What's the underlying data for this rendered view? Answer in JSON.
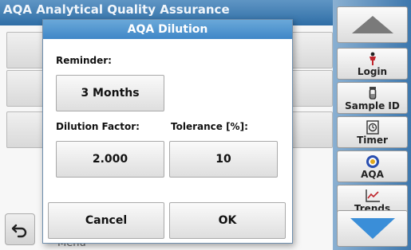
{
  "background": {
    "title": "AQA  Analytical Quality Assurance",
    "back_icon": "undo-arrow-icon",
    "menu_label": "Menu"
  },
  "toolbar": {
    "up": {
      "icon": "triangle-up-icon"
    },
    "login": {
      "label": "Login",
      "icon": "person-icon"
    },
    "sample_id": {
      "label": "Sample ID",
      "icon": "vial-icon"
    },
    "timer": {
      "label": "Timer",
      "icon": "timer-icon"
    },
    "aqa": {
      "label": "AQA",
      "icon": "aqa-icon"
    },
    "trends": {
      "label": "Trends",
      "icon": "trend-chart-icon"
    },
    "down": {
      "icon": "triangle-down-icon"
    }
  },
  "dialog": {
    "title": "AQA Dilution",
    "reminder_label": "Reminder:",
    "reminder_value": "3 Months",
    "dilution_label": "Dilution Factor:",
    "dilution_value": "2.000",
    "tolerance_label": "Tolerance [%]:",
    "tolerance_value": "10",
    "cancel_label": "Cancel",
    "ok_label": "OK"
  },
  "colors": {
    "title_blue": "#3f87c7",
    "toolbar_blue": "#3d77ad",
    "button_gray": "#dedede"
  }
}
